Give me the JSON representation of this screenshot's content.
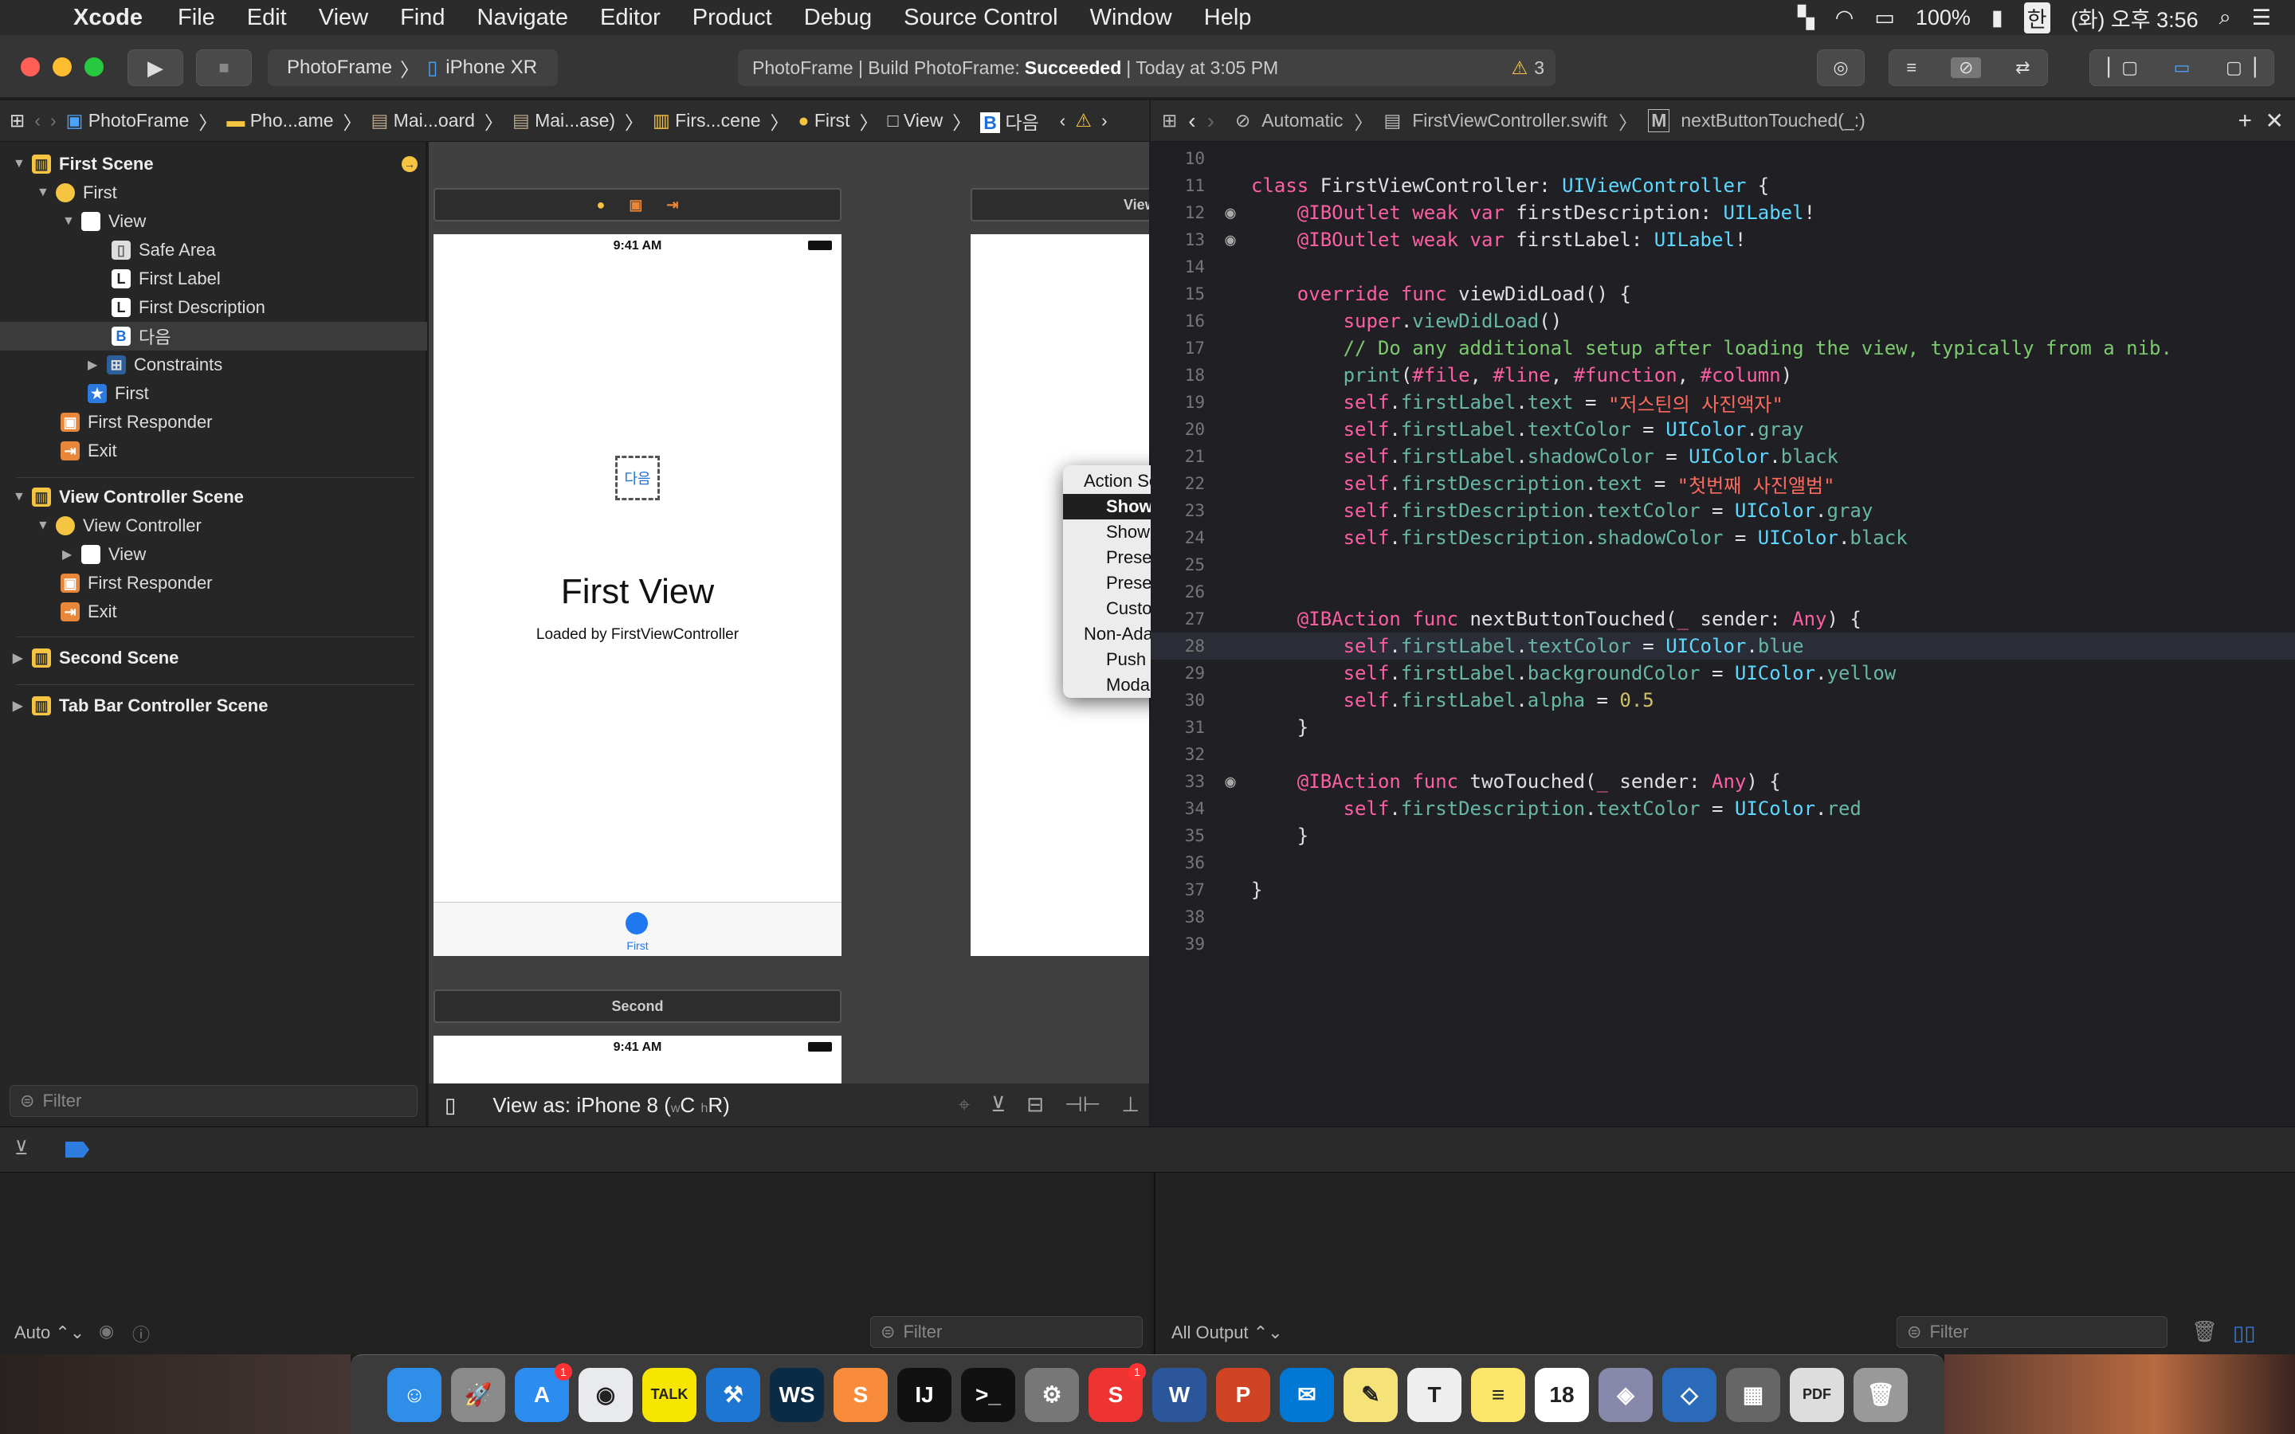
{
  "menubar": {
    "app": "Xcode",
    "items": [
      "File",
      "Edit",
      "View",
      "Find",
      "Navigate",
      "Editor",
      "Product",
      "Debug",
      "Source Control",
      "Window",
      "Help"
    ],
    "battery": "100%",
    "ime": "한",
    "clock": "(화) 오후 3:56"
  },
  "toolbar": {
    "scheme_project": "PhotoFrame",
    "scheme_device": "iPhone XR",
    "status_prefix": "PhotoFrame | Build PhotoFrame:",
    "status_result": "Succeeded",
    "status_time": "| Today at 3:05 PM",
    "warning_count": "3",
    "warning_color": "#f5c542"
  },
  "jumpbar_left": [
    "PhotoFrame",
    "Pho...ame",
    "Mai...oard",
    "Mai...ase)",
    "Firs...cene",
    "First",
    "View",
    "다음"
  ],
  "jumpbar_right": {
    "mode": "Automatic",
    "file": "FirstViewController.swift",
    "symbol": "nextButtonTouched(_:)"
  },
  "outline": {
    "rows": [
      {
        "label": "First Scene",
        "kind": "scene"
      },
      {
        "label": "First"
      },
      {
        "label": "View"
      },
      {
        "label": "Safe Area"
      },
      {
        "label": "First Label"
      },
      {
        "label": "First Description"
      },
      {
        "label": "다음"
      },
      {
        "label": "Constraints"
      },
      {
        "label": "First"
      },
      {
        "label": "First Responder"
      },
      {
        "label": "Exit"
      },
      {
        "label": "View Controller Scene",
        "kind": "scene"
      },
      {
        "label": "View Controller"
      },
      {
        "label": "View"
      },
      {
        "label": "First Responder"
      },
      {
        "label": "Exit"
      },
      {
        "label": "Second Scene",
        "kind": "scene"
      },
      {
        "label": "Tab Bar Controller Scene",
        "kind": "scene"
      }
    ],
    "filter_placeholder": "Filter"
  },
  "canvas": {
    "status_time": "9:41 AM",
    "title": "First View",
    "subtitle": "Loaded by FirstViewController",
    "tab_label": "First",
    "second_scene": "Second",
    "second_time": "9:41 AM",
    "right_scene": "View",
    "view_as": "View as: iPhone 8 (",
    "view_as_w": "w",
    "view_as_c": "C",
    "view_as_h": "h",
    "view_as_r": "R)"
  },
  "popup": {
    "header1": "Action Segue",
    "items1": [
      "Show",
      "Show Detail",
      "Present Modally",
      "Present As Popover",
      "Custom"
    ],
    "header2": "Non-Adaptive Action Segue",
    "items2": [
      "Push (deprecated)",
      "Modal (deprecated)"
    ],
    "highlighted": "Show"
  },
  "code": {
    "line_numbers": [
      "10",
      "11",
      "12",
      "13",
      "14",
      "15",
      "16",
      "17",
      "18",
      "19",
      "20",
      "21",
      "22",
      "23",
      "24",
      "25",
      "26",
      "27",
      "28",
      "29",
      "30",
      "31",
      "32",
      "33",
      "34",
      "35",
      "36",
      "37",
      "38",
      "39"
    ],
    "visible_line_numbers": [
      "10",
      "11",
      "14",
      "15",
      "16",
      "17",
      "18",
      "19",
      "20",
      "21",
      "30",
      "31",
      "32",
      "33",
      "34",
      "35",
      "36",
      "37",
      "38",
      "39"
    ],
    "class_decl": "FirstViewController",
    "superclass": "UIViewController",
    "outlet1": "firstDescription",
    "outlet2": "firstLabel",
    "comment": "// Do any additional setup after loading the view, typically from a nib.",
    "str1": "\"저스틴의 사진액자\"",
    "str2": "\"첫번째 사진앨범\"",
    "alpha": "0.5"
  },
  "debug": {
    "auto_label": "Auto",
    "filter_left": "Filter",
    "output_label": "All Output",
    "filter_right": "Filter"
  },
  "dock": [
    {
      "name": "Finder",
      "color": "#2f8ee8",
      "glyph": "☺"
    },
    {
      "name": "Launchpad",
      "color": "#8a8a8a",
      "glyph": "🚀"
    },
    {
      "name": "App Store",
      "color": "#2d8cf0",
      "glyph": "A",
      "badge": "1"
    },
    {
      "name": "Chrome",
      "color": "#e8eaed",
      "glyph": "◉"
    },
    {
      "name": "KakaoTalk",
      "color": "#f7e600",
      "glyph": "TALK"
    },
    {
      "name": "Xcode",
      "color": "#1c76d2",
      "glyph": "⚒"
    },
    {
      "name": "WebStorm",
      "color": "#0b2b44",
      "glyph": "WS"
    },
    {
      "name": "Sublime",
      "color": "#f98c3a",
      "glyph": "S"
    },
    {
      "name": "IntelliJ",
      "color": "#111",
      "glyph": "IJ"
    },
    {
      "name": "Terminal",
      "color": "#111",
      "glyph": ">_"
    },
    {
      "name": "Preferences",
      "color": "#777",
      "glyph": "⚙"
    },
    {
      "name": "Slides",
      "color": "#e33",
      "glyph": "S",
      "badge": "1"
    },
    {
      "name": "Word",
      "color": "#2b579a",
      "glyph": "W"
    },
    {
      "name": "PowerPoint",
      "color": "#d04423",
      "glyph": "P"
    },
    {
      "name": "Outlook",
      "color": "#0078d4",
      "glyph": "✉"
    },
    {
      "name": "Stickies",
      "color": "#f5e37a",
      "glyph": "✎"
    },
    {
      "name": "TextEdit",
      "color": "#eee",
      "glyph": "T"
    },
    {
      "name": "Notes",
      "color": "#fbe66a",
      "glyph": "≡"
    },
    {
      "name": "Calendar",
      "color": "#fff",
      "glyph": "18"
    },
    {
      "name": "Preview",
      "color": "#88a",
      "glyph": "◈"
    },
    {
      "name": "Instruments",
      "color": "#2a6ab8",
      "glyph": "◇"
    },
    {
      "name": "Calculator",
      "color": "#666",
      "glyph": "▦"
    },
    {
      "name": "PDF",
      "color": "#ddd",
      "glyph": "PDF"
    },
    {
      "name": "Trash",
      "color": "#999",
      "glyph": "🗑"
    }
  ]
}
